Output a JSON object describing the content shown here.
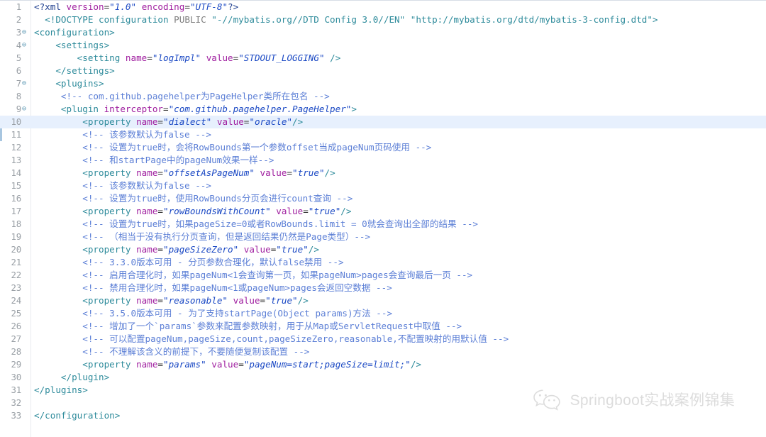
{
  "editor": {
    "language": "xml",
    "file_kind": "mybatis-config",
    "highlighted_line": 10,
    "colors": {
      "background": "#ffffff",
      "highlight_line": "#e7f0fd",
      "gutter_text": "#9aa0a6",
      "tag": "#2e8b9b",
      "attribute_name": "#a020a0",
      "attribute_value": "#1b49c4",
      "comment": "#5c7fd6",
      "processing_instruction": "#1f3f8f",
      "keyword_plain": "#808080",
      "change_bar": "#a8c6e0"
    },
    "fold_markers": [
      3,
      4,
      7,
      9
    ],
    "lines": [
      {
        "n": 1,
        "indent": "",
        "tokens": [
          {
            "t": "pi",
            "s": "<?xml "
          },
          {
            "t": "attr",
            "s": "version"
          },
          {
            "t": "eq",
            "s": "="
          },
          {
            "t": "val",
            "s": "\"1.0\""
          },
          {
            "t": "pi",
            "s": " "
          },
          {
            "t": "attr",
            "s": "encoding"
          },
          {
            "t": "eq",
            "s": "="
          },
          {
            "t": "val",
            "s": "\"UTF-8\""
          },
          {
            "t": "pi",
            "s": "?>"
          }
        ]
      },
      {
        "n": 2,
        "indent": "  ",
        "tokens": [
          {
            "t": "tag",
            "s": "<!DOCTYPE configuration "
          },
          {
            "t": "plain",
            "s": "PUBLIC"
          },
          {
            "t": "tag",
            "s": " \"-//mybatis.org//DTD Config 3.0//EN\" \"http://mybatis.org/dtd/mybatis-3-config.dtd\">"
          }
        ]
      },
      {
        "n": 3,
        "indent": "",
        "tokens": [
          {
            "t": "tag",
            "s": "<configuration>"
          }
        ]
      },
      {
        "n": 4,
        "indent": "    ",
        "tokens": [
          {
            "t": "tag",
            "s": "<settings>"
          }
        ]
      },
      {
        "n": 5,
        "indent": "        ",
        "tokens": [
          {
            "t": "tag",
            "s": "<setting "
          },
          {
            "t": "attr",
            "s": "name"
          },
          {
            "t": "eq",
            "s": "="
          },
          {
            "t": "val",
            "s": "\"logImpl\""
          },
          {
            "t": "tag",
            "s": " "
          },
          {
            "t": "attr",
            "s": "value"
          },
          {
            "t": "eq",
            "s": "="
          },
          {
            "t": "val",
            "s": "\"STDOUT_LOGGING\""
          },
          {
            "t": "tag",
            "s": " />"
          }
        ]
      },
      {
        "n": 6,
        "indent": "    ",
        "tokens": [
          {
            "t": "tag",
            "s": "</settings>"
          }
        ]
      },
      {
        "n": 7,
        "indent": "    ",
        "tokens": [
          {
            "t": "tag",
            "s": "<plugins>"
          }
        ]
      },
      {
        "n": 8,
        "indent": "     ",
        "tokens": [
          {
            "t": "comment",
            "s": "<!-- com.github.pagehelper为PageHelper类所在包名 -->"
          }
        ]
      },
      {
        "n": 9,
        "indent": "     ",
        "tokens": [
          {
            "t": "tag",
            "s": "<plugin "
          },
          {
            "t": "attr",
            "s": "interceptor"
          },
          {
            "t": "eq",
            "s": "="
          },
          {
            "t": "val",
            "s": "\"com.github.pagehelper.PageHelper\""
          },
          {
            "t": "tag",
            "s": ">"
          }
        ]
      },
      {
        "n": 10,
        "indent": "         ",
        "tokens": [
          {
            "t": "tag",
            "s": "<property "
          },
          {
            "t": "attr",
            "s": "name"
          },
          {
            "t": "eq",
            "s": "="
          },
          {
            "t": "val",
            "s": "\"dialect\""
          },
          {
            "t": "tag",
            "s": " "
          },
          {
            "t": "attr",
            "s": "value"
          },
          {
            "t": "eq",
            "s": "="
          },
          {
            "t": "val",
            "s": "\"oracle\""
          },
          {
            "t": "tag",
            "s": "/>"
          }
        ]
      },
      {
        "n": 11,
        "indent": "         ",
        "tokens": [
          {
            "t": "comment",
            "s": "<!-- 该参数默认为false -->"
          }
        ]
      },
      {
        "n": 12,
        "indent": "         ",
        "tokens": [
          {
            "t": "comment",
            "s": "<!-- 设置为true时，会将RowBounds第一个参数offset当成pageNum页码使用 -->"
          }
        ]
      },
      {
        "n": 13,
        "indent": "         ",
        "tokens": [
          {
            "t": "comment",
            "s": "<!-- 和startPage中的pageNum效果一样-->"
          }
        ]
      },
      {
        "n": 14,
        "indent": "         ",
        "tokens": [
          {
            "t": "tag",
            "s": "<property "
          },
          {
            "t": "attr",
            "s": "name"
          },
          {
            "t": "eq",
            "s": "="
          },
          {
            "t": "val",
            "s": "\"offsetAsPageNum\""
          },
          {
            "t": "tag",
            "s": " "
          },
          {
            "t": "attr",
            "s": "value"
          },
          {
            "t": "eq",
            "s": "="
          },
          {
            "t": "val",
            "s": "\"true\""
          },
          {
            "t": "tag",
            "s": "/>"
          }
        ]
      },
      {
        "n": 15,
        "indent": "         ",
        "tokens": [
          {
            "t": "comment",
            "s": "<!-- 该参数默认为false -->"
          }
        ]
      },
      {
        "n": 16,
        "indent": "         ",
        "tokens": [
          {
            "t": "comment",
            "s": "<!-- 设置为true时，使用RowBounds分页会进行count查询 -->"
          }
        ]
      },
      {
        "n": 17,
        "indent": "         ",
        "tokens": [
          {
            "t": "tag",
            "s": "<property "
          },
          {
            "t": "attr",
            "s": "name"
          },
          {
            "t": "eq",
            "s": "="
          },
          {
            "t": "val",
            "s": "\"rowBoundsWithCount\""
          },
          {
            "t": "tag",
            "s": " "
          },
          {
            "t": "attr",
            "s": "value"
          },
          {
            "t": "eq",
            "s": "="
          },
          {
            "t": "val",
            "s": "\"true\""
          },
          {
            "t": "tag",
            "s": "/>"
          }
        ]
      },
      {
        "n": 18,
        "indent": "         ",
        "tokens": [
          {
            "t": "comment",
            "s": "<!-- 设置为true时，如果pageSize=0或者RowBounds.limit = 0就会查询出全部的结果 -->"
          }
        ]
      },
      {
        "n": 19,
        "indent": "         ",
        "tokens": [
          {
            "t": "comment",
            "s": "<!-- （相当于没有执行分页查询，但是返回结果仍然是Page类型）-->"
          }
        ]
      },
      {
        "n": 20,
        "indent": "         ",
        "tokens": [
          {
            "t": "tag",
            "s": "<property "
          },
          {
            "t": "attr",
            "s": "name"
          },
          {
            "t": "eq",
            "s": "="
          },
          {
            "t": "val",
            "s": "\"pageSizeZero\""
          },
          {
            "t": "tag",
            "s": " "
          },
          {
            "t": "attr",
            "s": "value"
          },
          {
            "t": "eq",
            "s": "="
          },
          {
            "t": "val",
            "s": "\"true\""
          },
          {
            "t": "tag",
            "s": "/>"
          }
        ]
      },
      {
        "n": 21,
        "indent": "         ",
        "tokens": [
          {
            "t": "comment",
            "s": "<!-- 3.3.0版本可用 - 分页参数合理化，默认false禁用 -->"
          }
        ]
      },
      {
        "n": 22,
        "indent": "         ",
        "tokens": [
          {
            "t": "comment",
            "s": "<!-- 启用合理化时，如果pageNum<1会查询第一页，如果pageNum>pages会查询最后一页 -->"
          }
        ]
      },
      {
        "n": 23,
        "indent": "         ",
        "tokens": [
          {
            "t": "comment",
            "s": "<!-- 禁用合理化时，如果pageNum<1或pageNum>pages会返回空数据 -->"
          }
        ]
      },
      {
        "n": 24,
        "indent": "         ",
        "tokens": [
          {
            "t": "tag",
            "s": "<property "
          },
          {
            "t": "attr",
            "s": "name"
          },
          {
            "t": "eq",
            "s": "="
          },
          {
            "t": "val",
            "s": "\"reasonable\""
          },
          {
            "t": "tag",
            "s": " "
          },
          {
            "t": "attr",
            "s": "value"
          },
          {
            "t": "eq",
            "s": "="
          },
          {
            "t": "val",
            "s": "\"true\""
          },
          {
            "t": "tag",
            "s": "/>"
          }
        ]
      },
      {
        "n": 25,
        "indent": "         ",
        "tokens": [
          {
            "t": "comment",
            "s": "<!-- 3.5.0版本可用 - 为了支持startPage(Object params)方法 -->"
          }
        ]
      },
      {
        "n": 26,
        "indent": "         ",
        "tokens": [
          {
            "t": "comment",
            "s": "<!-- 增加了一个`params`参数来配置参数映射，用于从Map或ServletRequest中取值 -->"
          }
        ]
      },
      {
        "n": 27,
        "indent": "         ",
        "tokens": [
          {
            "t": "comment",
            "s": "<!-- 可以配置pageNum,pageSize,count,pageSizeZero,reasonable,不配置映射的用默认值 -->"
          }
        ]
      },
      {
        "n": 28,
        "indent": "         ",
        "tokens": [
          {
            "t": "comment",
            "s": "<!-- 不理解该含义的前提下，不要随便复制该配置 -->"
          }
        ]
      },
      {
        "n": 29,
        "indent": "         ",
        "tokens": [
          {
            "t": "tag",
            "s": "<property "
          },
          {
            "t": "attr",
            "s": "name"
          },
          {
            "t": "eq",
            "s": "="
          },
          {
            "t": "val",
            "s": "\"params\""
          },
          {
            "t": "tag",
            "s": " "
          },
          {
            "t": "attr",
            "s": "value"
          },
          {
            "t": "eq",
            "s": "="
          },
          {
            "t": "val",
            "s": "\"pageNum=start;pageSize=limit;\""
          },
          {
            "t": "tag",
            "s": "/>"
          }
        ]
      },
      {
        "n": 30,
        "indent": "     ",
        "tokens": [
          {
            "t": "tag",
            "s": "</plugin>"
          }
        ]
      },
      {
        "n": 31,
        "indent": "",
        "tokens": [
          {
            "t": "tag",
            "s": "</plugins>"
          }
        ]
      },
      {
        "n": 32,
        "indent": "",
        "tokens": []
      },
      {
        "n": 33,
        "indent": "",
        "tokens": [
          {
            "t": "tag",
            "s": "</configuration>"
          }
        ]
      }
    ]
  },
  "watermark": {
    "icon": "wechat-icon",
    "text": "Springboot实战案例锦集"
  }
}
